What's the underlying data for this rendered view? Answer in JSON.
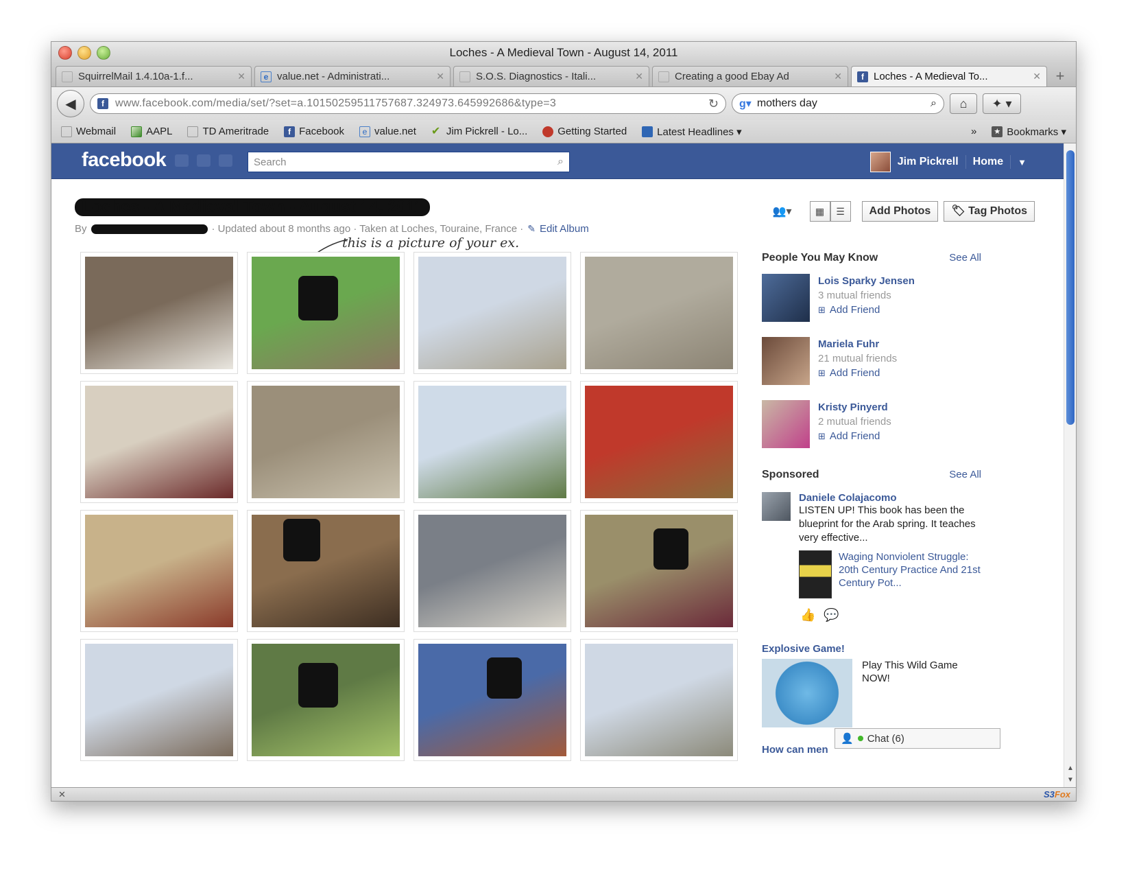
{
  "window": {
    "title": "Loches - A Medieval Town - August 14, 2011"
  },
  "tabs": [
    {
      "label": "SquirrelMail 1.4.10a-1.f...",
      "icon": "page-icon",
      "active": false
    },
    {
      "label": "value.net - Administrati...",
      "icon": "ie-icon",
      "active": false
    },
    {
      "label": "S.O.S. Diagnostics - Itali...",
      "icon": "page-icon",
      "active": false
    },
    {
      "label": "Creating a good Ebay Ad",
      "icon": "page-icon",
      "active": false
    },
    {
      "label": "Loches - A Medieval To...",
      "icon": "facebook-icon",
      "active": true
    }
  ],
  "navbar": {
    "url": "www.facebook.com/media/set/?set=a.10150259511757687.324973.645992686&type=3",
    "search_value": "mothers day"
  },
  "bookmarks": [
    {
      "label": "Webmail",
      "icon": "page-icon"
    },
    {
      "label": "AAPL",
      "icon": "chart-icon"
    },
    {
      "label": "TD Ameritrade",
      "icon": "page-icon"
    },
    {
      "label": "Facebook",
      "icon": "facebook-icon"
    },
    {
      "label": "value.net",
      "icon": "ie-icon"
    },
    {
      "label": "Jim Pickrell - Lo...",
      "icon": "check-icon"
    },
    {
      "label": "Getting Started",
      "icon": "firefox-icon"
    },
    {
      "label": "Latest Headlines ▾",
      "icon": "rss-icon"
    }
  ],
  "bookmarks_more": "»",
  "bookmarks_menu": "Bookmarks ▾",
  "fb": {
    "logo": "facebook",
    "search_placeholder": "Search",
    "user_name": "Jim Pickrell",
    "home": "Home"
  },
  "album": {
    "title": "Loches - A Medieval Town - August 14, 2011",
    "by": "By",
    "meta": "· Updated about 8 months ago · Taken at Loches, Touraine, France ·",
    "edit": "Edit Album",
    "handwritten_note": "this is a picture of your ex.",
    "add_photos": "Add Photos",
    "tag_photos": "Tag Photos"
  },
  "photos": [
    {
      "desc": "two men in medieval shirts",
      "c1": "#7a6a5a",
      "c2": "#e9e6df"
    },
    {
      "desc": "woman holding owl",
      "c1": "#6aa84f",
      "c2": "#8c7763",
      "redact": true
    },
    {
      "desc": "castle keep tower",
      "c1": "#cfd8e4",
      "c2": "#a9a28f"
    },
    {
      "desc": "catapults courtyard",
      "c1": "#b0ab9d",
      "c2": "#8c8474"
    },
    {
      "desc": "clothing market stall",
      "c1": "#d8cfc0",
      "c2": "#6b2a2a"
    },
    {
      "desc": "stone building",
      "c1": "#9b8f7a",
      "c2": "#c9c1ae"
    },
    {
      "desc": "church spires",
      "c1": "#cfdbe8",
      "c2": "#5f7a45"
    },
    {
      "desc": "woman in hat with map",
      "c1": "#c0392b",
      "c2": "#8a6a3a"
    },
    {
      "desc": "banquet hall",
      "c1": "#c8b28a",
      "c2": "#8a3a2a"
    },
    {
      "desc": "costumed couple",
      "c1": "#8a6d4e",
      "c2": "#3d2e22",
      "redact": true
    },
    {
      "desc": "chateau rooftops",
      "c1": "#7a7f87",
      "c2": "#d6d2c8"
    },
    {
      "desc": "costumed woman cooking",
      "c1": "#9a8f6a",
      "c2": "#6b2a3a",
      "redact": true
    },
    {
      "desc": "tent near chateau",
      "c1": "#cfd8e4",
      "c2": "#7a6a5a"
    },
    {
      "desc": "costumed people in forest",
      "c1": "#5f7a45",
      "c2": "#a6c46a",
      "redact": true
    },
    {
      "desc": "medieval parade",
      "c1": "#4a6aa8",
      "c2": "#a35a3a",
      "redact": true
    },
    {
      "desc": "chateau with crowd",
      "c1": "#cfd8e4",
      "c2": "#8c8a7a"
    }
  ],
  "pymk": {
    "heading": "People You May Know",
    "see_all": "See All",
    "people": [
      {
        "name": "Lois Sparky Jensen",
        "mutual": "3 mutual friends",
        "action": "Add Friend"
      },
      {
        "name": "Mariela Fuhr",
        "mutual": "21 mutual friends",
        "action": "Add Friend"
      },
      {
        "name": "Kristy Pinyerd",
        "mutual": "2 mutual friends",
        "action": "Add Friend"
      }
    ]
  },
  "sponsored": {
    "heading": "Sponsored",
    "see_all": "See All",
    "ad_title": "Daniele Colajacomo",
    "ad_body": "LISTEN UP! This book has been the blueprint for the Arab spring. It teaches very effective...",
    "book_title": "Waging Nonviolent Struggle: 20th Century Practice And 21st Century Pot...",
    "game_title": "Explosive Game!",
    "game_body": "Play This Wild Game NOW!",
    "next_title": "How can men"
  },
  "chat": {
    "label": "Chat (6)"
  },
  "statusbar": {
    "close": "✕",
    "addon_a": "S3",
    "addon_b": "Fox"
  }
}
